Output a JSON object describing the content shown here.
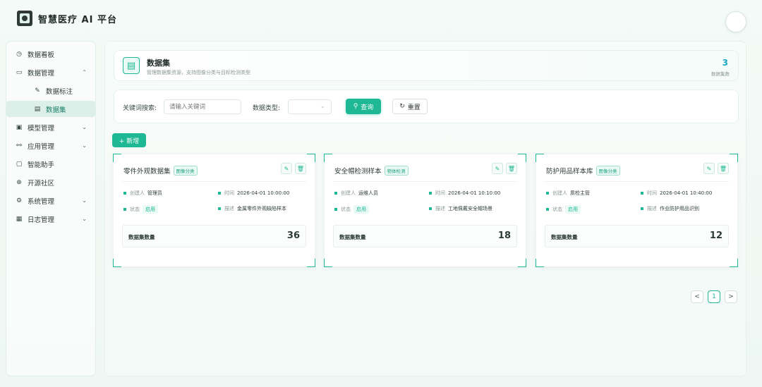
{
  "app": {
    "title": "智慧医疗 AI 平台"
  },
  "sidebar": {
    "items": [
      {
        "label": "数据看板",
        "icon": "dashboard-icon",
        "glyph": "◷",
        "arrow": ""
      },
      {
        "label": "数据管理",
        "icon": "database-icon",
        "glyph": "▭",
        "arrow": "⌃"
      },
      {
        "label": "数据标注",
        "icon": "edit-icon",
        "glyph": "✎",
        "arrow": ""
      },
      {
        "label": "数据集",
        "icon": "dataset-icon",
        "glyph": "▤",
        "arrow": ""
      },
      {
        "label": "模型管理",
        "icon": "model-icon",
        "glyph": "▣",
        "arrow": "⌄"
      },
      {
        "label": "应用管理",
        "icon": "app-icon",
        "glyph": "⚯",
        "arrow": "⌄"
      },
      {
        "label": "智能助手",
        "icon": "assistant-icon",
        "glyph": "▢",
        "arrow": ""
      },
      {
        "label": "开源社区",
        "icon": "community-icon",
        "glyph": "⊕",
        "arrow": ""
      },
      {
        "label": "系统管理",
        "icon": "settings-icon",
        "glyph": "⚙",
        "arrow": "⌄"
      },
      {
        "label": "日志管理",
        "icon": "log-icon",
        "glyph": "▦",
        "arrow": "⌄"
      }
    ]
  },
  "header": {
    "title": "数据集",
    "subtitle": "管理数据集资源，支持图像分类与目标检测类型",
    "count": "3",
    "count_label": "数据集数"
  },
  "search": {
    "keyword_label": "关键词搜索:",
    "keyword_placeholder": "请输入关键词",
    "type_label": "数据类型:",
    "query_label": "查询",
    "reset_label": "重置"
  },
  "toolbar": {
    "add_label": "+ 新增"
  },
  "cards": [
    {
      "title": "零件外观数据集",
      "tag": "图像分类",
      "creator_label": "创建人",
      "creator": "管理员",
      "time_label": "时间",
      "time": "2026-04-01 10:00:00",
      "status_label": "状态",
      "status": "启用",
      "desc_label": "描述",
      "desc": "金属零件外观缺陷样本",
      "count_label": "数据集数量",
      "count": "36"
    },
    {
      "title": "安全帽检测样本",
      "tag": "物体检测",
      "creator_label": "创建人",
      "creator": "运维人员",
      "time_label": "时间",
      "time": "2026-04-01 10:10:00",
      "status_label": "状态",
      "status": "启用",
      "desc_label": "描述",
      "desc": "工地佩戴安全帽场景",
      "count_label": "数据集数量",
      "count": "18"
    },
    {
      "title": "防护用品样本库",
      "tag": "图像分类",
      "creator_label": "创建人",
      "creator": "质检主管",
      "time_label": "时间",
      "time": "2026-04-01 10:40:00",
      "status_label": "状态",
      "status": "启用",
      "desc_label": "描述",
      "desc": "作业防护用品识别",
      "count_label": "数据集数量",
      "count": "12"
    }
  ],
  "pagination": {
    "prev": "<",
    "current": "1",
    "next": ">"
  },
  "colors": {
    "accent": "#1fb894",
    "count": "#1ba7c4"
  }
}
